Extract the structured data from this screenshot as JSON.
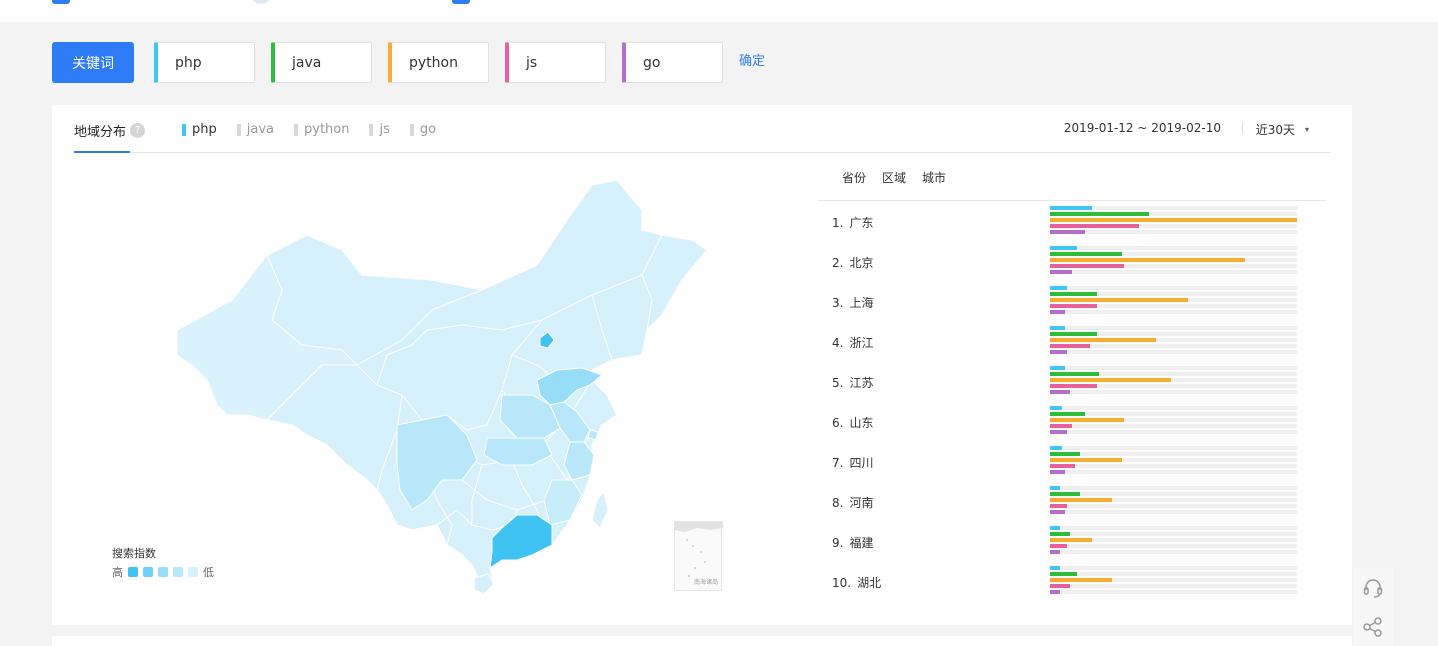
{
  "keywords": {
    "label": "关键词",
    "items": [
      {
        "text": "php",
        "color": "#3ec6f4"
      },
      {
        "text": "java",
        "color": "#2ebd3a"
      },
      {
        "text": "python",
        "color": "#f8ac32"
      },
      {
        "text": "js",
        "color": "#e8619e"
      },
      {
        "text": "go",
        "color": "#b46fc8"
      }
    ],
    "confirm": "确定"
  },
  "panel": {
    "title": "地域分布",
    "help_icon": "question-icon",
    "help_glyph": "?",
    "tabs": [
      {
        "label": "php",
        "active": true,
        "color": "#3ec6f4"
      },
      {
        "label": "java",
        "active": false
      },
      {
        "label": "python",
        "active": false
      },
      {
        "label": "js",
        "active": false
      },
      {
        "label": "go",
        "active": false
      }
    ],
    "date_range": "2019-01-12 ~ 2019-02-10",
    "period": "近30天",
    "period_caret": "▾"
  },
  "map": {
    "legend_title": "搜索指数",
    "legend_high": "高",
    "legend_low": "低",
    "scale_colors": [
      "#3fc3f2",
      "#6fd1f5",
      "#97ddf7",
      "#b7e7f9",
      "#d6f1fb"
    ],
    "inset_label": "南海诸岛"
  },
  "ranking": {
    "tabs": [
      "省份",
      "区域",
      "城市"
    ],
    "colors": [
      "#3ec6f4",
      "#2ebd3a",
      "#f8ac32",
      "#e8619e",
      "#b46fc8"
    ],
    "rows": [
      {
        "rank": "1.",
        "name": "广东",
        "values": [
          0.17,
          0.4,
          1.0,
          0.36,
          0.14
        ]
      },
      {
        "rank": "2.",
        "name": "北京",
        "values": [
          0.11,
          0.29,
          0.79,
          0.3,
          0.09
        ]
      },
      {
        "rank": "3.",
        "name": "上海",
        "values": [
          0.07,
          0.19,
          0.56,
          0.19,
          0.06
        ]
      },
      {
        "rank": "4.",
        "name": "浙江",
        "values": [
          0.06,
          0.19,
          0.43,
          0.16,
          0.07
        ]
      },
      {
        "rank": "5.",
        "name": "江苏",
        "values": [
          0.06,
          0.2,
          0.49,
          0.19,
          0.08
        ]
      },
      {
        "rank": "6.",
        "name": "山东",
        "values": [
          0.05,
          0.14,
          0.3,
          0.09,
          0.07
        ]
      },
      {
        "rank": "7.",
        "name": "四川",
        "values": [
          0.05,
          0.12,
          0.29,
          0.1,
          0.06
        ]
      },
      {
        "rank": "8.",
        "name": "河南",
        "values": [
          0.04,
          0.12,
          0.25,
          0.07,
          0.06
        ]
      },
      {
        "rank": "9.",
        "name": "福建",
        "values": [
          0.04,
          0.08,
          0.17,
          0.07,
          0.04
        ]
      },
      {
        "rank": "10.",
        "name": "湖北",
        "values": [
          0.04,
          0.11,
          0.25,
          0.08,
          0.04
        ]
      }
    ]
  },
  "side_tools": [
    "headset-icon",
    "share-icon"
  ]
}
